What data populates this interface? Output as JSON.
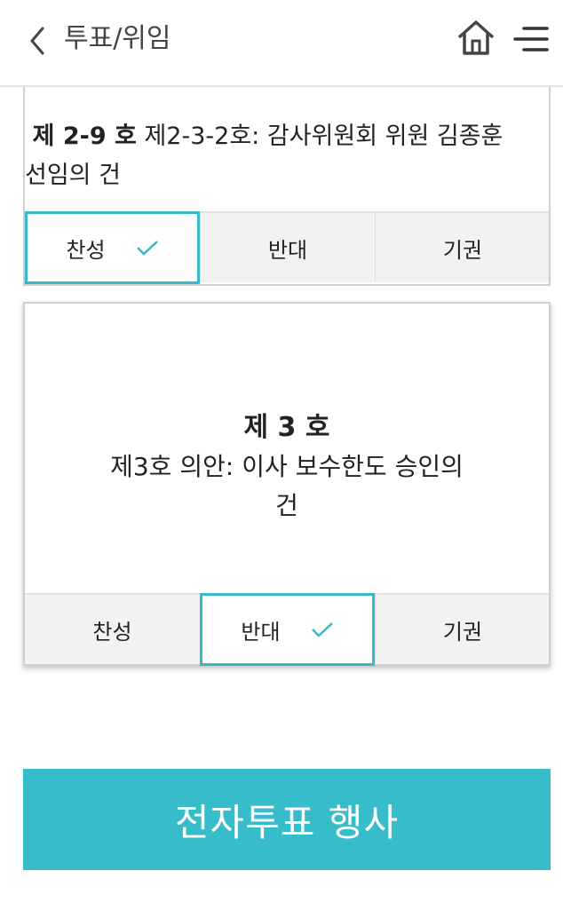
{
  "header": {
    "title": "투표/위임"
  },
  "agenda_prev": {
    "number": "제 2-9 호",
    "title_line1": "제2-3-2호: 감사위원회 위원 김종훈",
    "title_line2": "선임의 건",
    "selected": "approve"
  },
  "agenda_3": {
    "number": "제 3 호",
    "title_line1": "제3호 의안: 이사 보수한도 승인의",
    "title_line2": "건",
    "selected": "oppose"
  },
  "vote_options": {
    "approve": "찬성",
    "oppose": "반대",
    "abstain": "기권"
  },
  "submit": {
    "label": "전자투표 행사"
  },
  "colors": {
    "accent": "#37bcca",
    "selected_border": "#37b9c9",
    "row_bg": "#f2f2f2"
  },
  "icons": {
    "back": "chevron-left-icon",
    "home": "home-icon",
    "menu": "hamburger-menu-icon",
    "check": "check-icon"
  }
}
